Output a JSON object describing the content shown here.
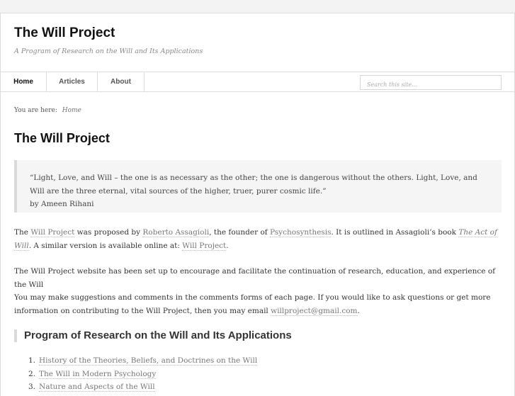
{
  "site": {
    "title": "The Will Project",
    "description": "A Program of Research on the Will and Its Applications"
  },
  "nav": {
    "items": [
      {
        "label": "Home",
        "active": true
      },
      {
        "label": "Articles",
        "active": false
      },
      {
        "label": "About",
        "active": false
      }
    ],
    "search_placeholder": "Search this site..."
  },
  "breadcrumb": {
    "prefix": "You are here:",
    "current": "Home"
  },
  "entry": {
    "title": "The Will Project",
    "quote": {
      "text": "“Light, Love, and Will – the one is as necessary as the other; the one is dangerous without the others. Light, Love, and Will are the three eternal, vital sources of the higher, truer, purer cosmic life.”",
      "attribution": "by Ameen Rihani"
    },
    "p1": {
      "t1": "The ",
      "link1": "Will Project",
      "t2": " was proposed by ",
      "link2": "Roberto Assagioli",
      "t3": ", the founder of ",
      "link3": "Psychosynthesis",
      "t4": ". It is outlined in Assagioli’s book ",
      "link4": "The Act of Will",
      "t5": ". A similar version is available online at: ",
      "link5": "Will Project",
      "t6": "."
    },
    "p2": "The Will Project website has been set up to encourage and facilitate the continuation of research, education, and experience of the Will",
    "p3": {
      "t1": "You may make suggestions and comments in the comments forms of each page. If you would like to ask questions or get more information on contributing to the Will Project, then you may email ",
      "email": "willproject@gmail.com",
      "t2": "."
    },
    "section_heading": "Program of Research on the Will and Its Applications",
    "list": [
      {
        "num": "1.",
        "label": "History of the Theories, Beliefs, and Doctrines on the Will"
      },
      {
        "num": "2.",
        "label": "The Will in Modern Psychology"
      },
      {
        "num": "3.",
        "label": "Nature and Aspects of the Will"
      }
    ]
  },
  "colors": {
    "link": "#777777",
    "heading": "#111111",
    "border": "#dcdcdc",
    "quote_bg": "#f5f5f5"
  }
}
